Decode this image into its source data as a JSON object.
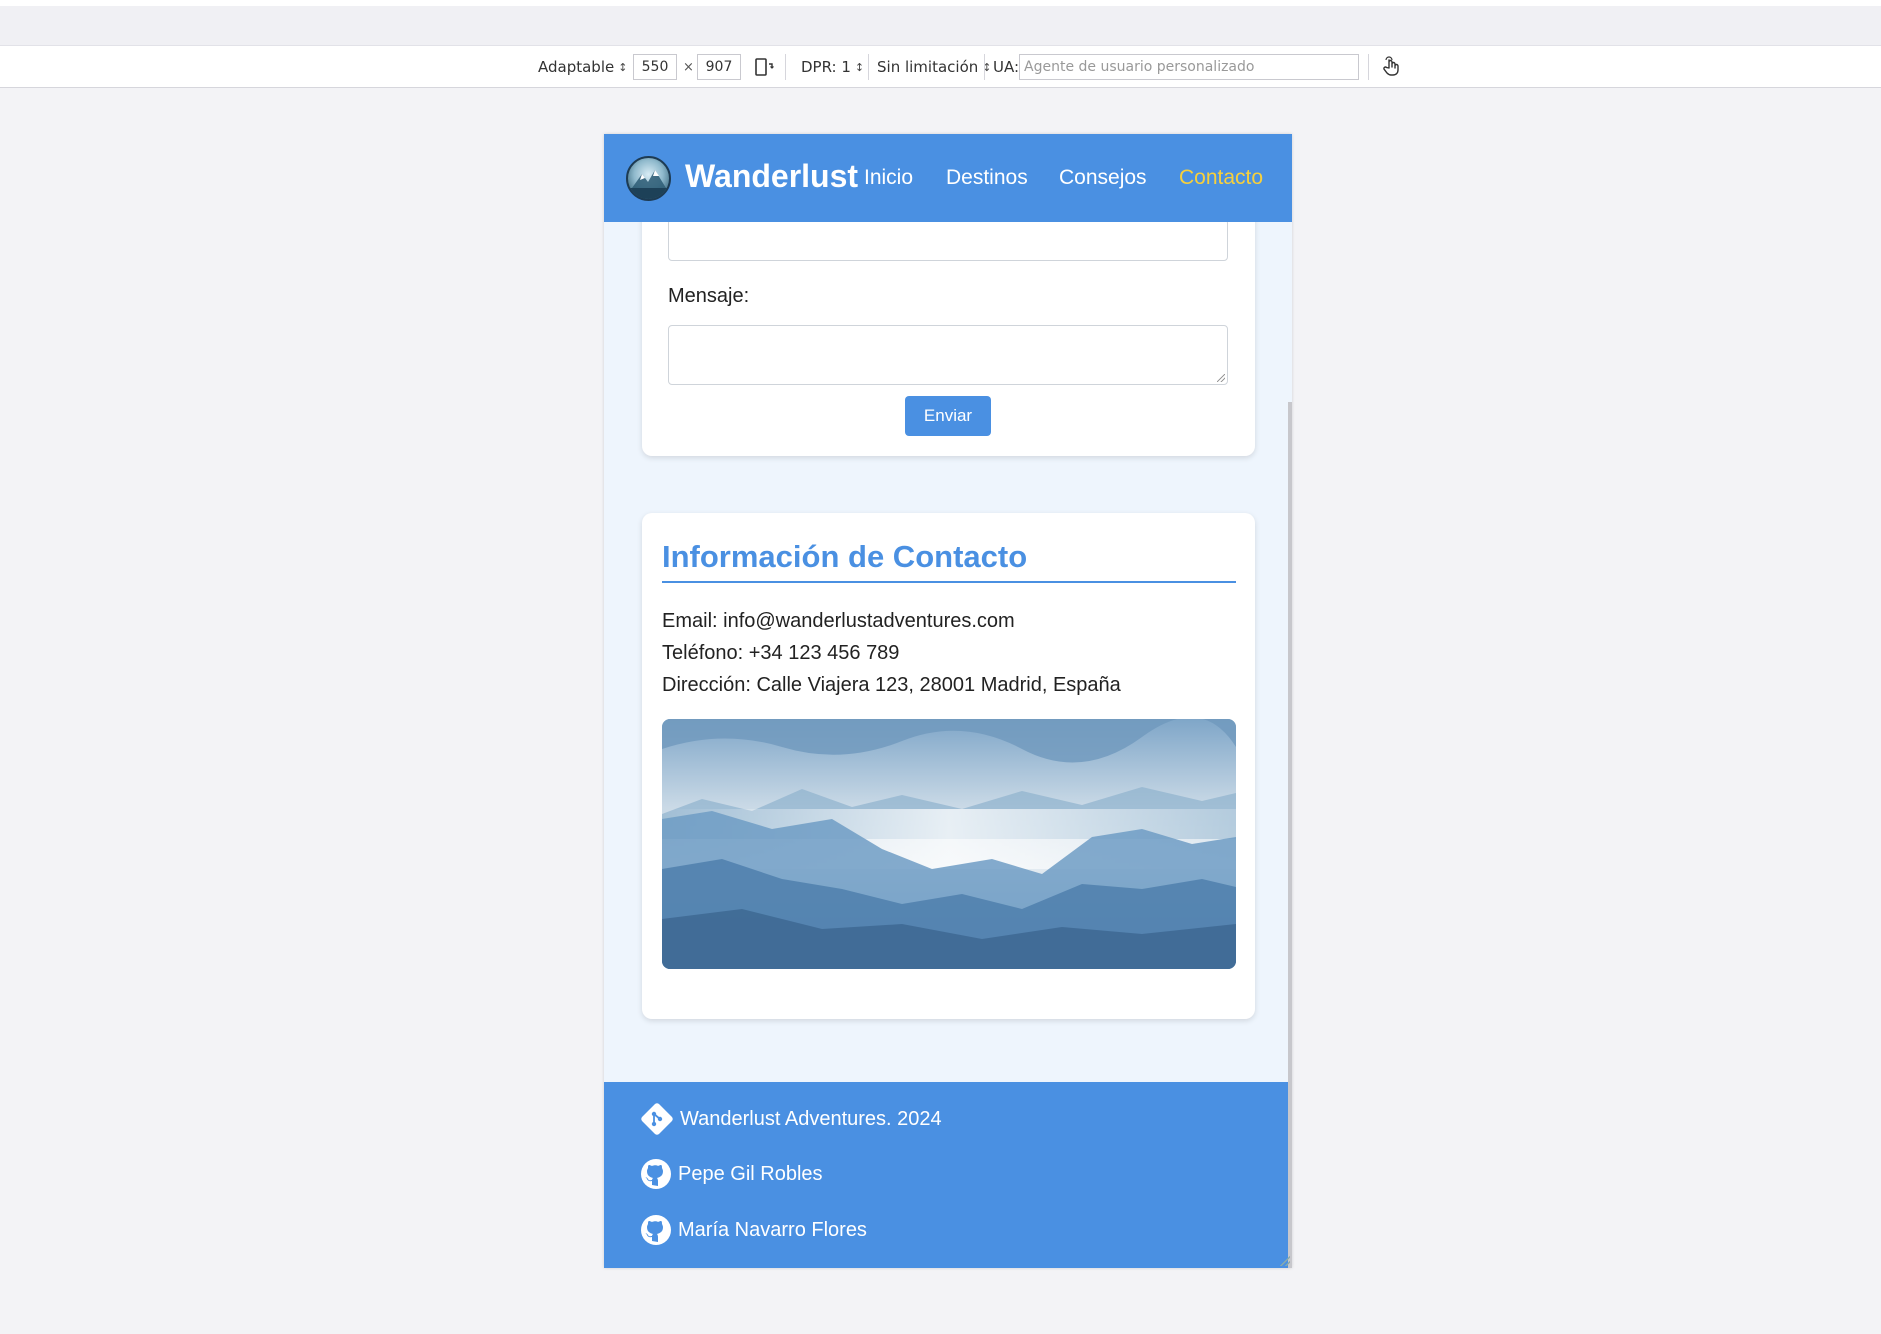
{
  "toolbar": {
    "device_mode": "Adaptable",
    "width": "550",
    "height": "907",
    "times": "×",
    "dpr": "DPR: 1",
    "throttle": "Sin limitación",
    "ua_label": "UA:",
    "ua_placeholder": "Agente de usuario personalizado",
    "icons": [
      "rotate-device-icon",
      "touch-simulation-icon"
    ]
  },
  "site": {
    "brand": "Wanderlust",
    "nav": [
      {
        "label": "Inicio",
        "active": false
      },
      {
        "label": "Destinos",
        "active": false
      },
      {
        "label": "Consejos",
        "active": false
      },
      {
        "label": "Contacto",
        "active": true
      }
    ],
    "form": {
      "message_label": "Mensaje:",
      "submit_label": "Enviar"
    },
    "info": {
      "title": "Información de Contacto",
      "email": "Email: info@wanderlustadventures.com",
      "phone": "Teléfono: +34 123 456 789",
      "address": "Dirección: Calle Viajera 123, 28001 Madrid, España"
    },
    "footer": {
      "copyright": "Wanderlust Adventures. 2024",
      "authors": [
        "Pepe Gil Robles",
        "María Navarro Flores"
      ]
    }
  },
  "colors": {
    "header_bg": "#4a90e2",
    "nav_active": "#f7d03c",
    "page_bg": "#eef5fd",
    "accent": "#4a90e2"
  }
}
